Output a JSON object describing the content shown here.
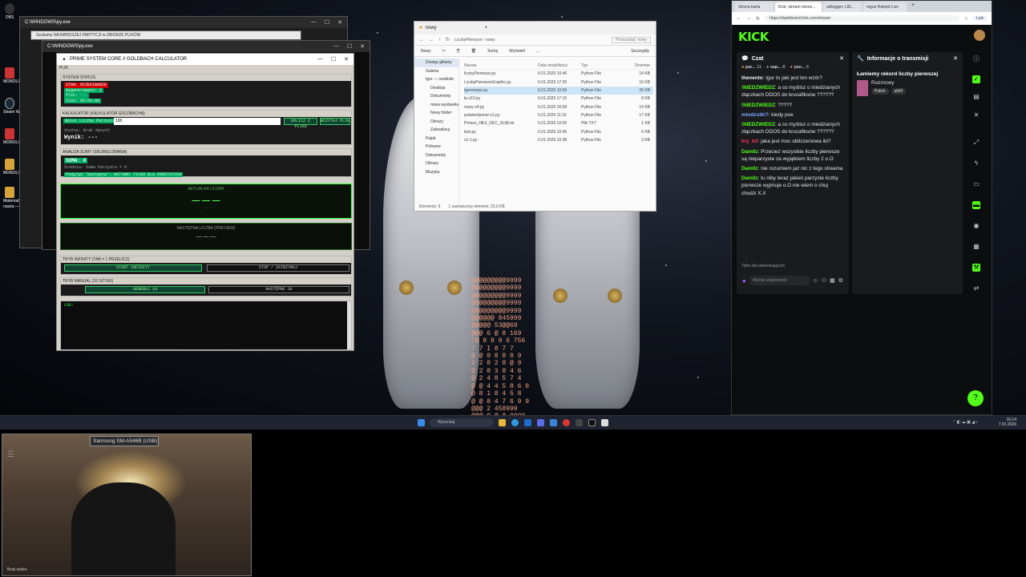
{
  "desktop": {
    "icons": [
      {
        "label": "OBS"
      },
      {
        "label": "MONOLI"
      },
      {
        "label": "Steam W..."
      },
      {
        "label": "MONOLI"
      },
      {
        "label": "MONOLI"
      },
      {
        "label": "MONOLI"
      },
      {
        "label": "Matematyczny"
      },
      {
        "label": "nauka — kopia"
      }
    ],
    "wallpaper_matrix": "@@@@@@@@@9999\n@@@@@@@@@9999\n@@@@@@@@@9999\n@@@@@@@@@9999\n@@@@@@@@@9999\n@@@@@@ 845999\n@@@@@ 53@@69\n@@@ 6 @ 8 169\n7@ 8 8 9 6 756\n7 7 I 8 7 7\n@ @ 0 8 8 0 9\n2 2 8 2 8 @ 9\n@ 2 8 3 8 4 6\n@ 2 4 8 5 7 4\n@ @ 4 4 5 8 6 0\n@ 8 1 8 4 5 8\n@ @ 8 4 7 6 9 9\n@@@ 2 458999\n@@@ 9 @ 8 9999\n@@@ 8 @ 9999\n@@@@@@@@@9999\n@@@@@@@@@9999\n@@@@@@@@@9999"
  },
  "console_windows": [
    {
      "title": "C:\\WINDOWS\\py.exe",
      "controls": [
        "—",
        "☐",
        "✕"
      ]
    },
    {
      "title": "Szukamy NAJWIĘKSZEJ PARTYCJI w ZBIORZE PLIKÓW",
      "controls": []
    },
    {
      "title": "C:\\WINDOWS\\py.exe",
      "controls": [
        "—",
        "☐",
        "✕"
      ]
    }
  ],
  "pyapp": {
    "title": "PRIME SYSTEM CORE // GOLDBACH CALCULATOR",
    "menu": "PLIK",
    "system_status": {
      "header": "SYSTEM STATUS",
      "lines": [
        "STAN: OCZEKIWANIE",
        "Wygenerowano: 0",
        "Plik: ---",
        "Czas: 00:00:00"
      ]
    },
    "goldbach": {
      "header": "KALKULATOR (KALKULATOR GOLDBACHA)",
      "input_label": "Wpisz Liczbę Parzystą:",
      "input_value": "100",
      "btn_load": "DOLICZ Z PLIKU",
      "btn_read": "WCZYTAJ PLIK",
      "status": "Status: Brak danych",
      "result_label": "Wynik:",
      "result_value": "---"
    },
    "sum_analysis": {
      "header": "ANALIZA SUMY (SKUMULOWANA)",
      "sum_label": "SUMA: 0",
      "line1": "Średnia: Suma Parzysta = 0",
      "line2": "Podgląd 'Następna': AKTYWNY TYLKO DLA PARZYSTYCH"
    },
    "current_number": {
      "label": "AKTUALNA LICZBA",
      "value": "— — —",
      "sub": "..."
    },
    "next_number": {
      "label": "NASTĘPNA LICZBA (PREVIEW)",
      "value": "— — —",
      "sub": "..."
    },
    "infinity_mode": {
      "header": "TRYB INFINITY (TAB = 1 PRZELICZ)",
      "btn_start": "START INFINITY",
      "btn_stop": "STOP / ZATRZYMAJ"
    },
    "manual_mode": {
      "header": "TRYB MANUAL (10 SZTUK)",
      "btn_gen": "GENERUJ 10",
      "btn_next": "NASTĘPNE 10"
    },
    "log_label": "LOG:"
  },
  "explorer": {
    "tab_title": "nowy",
    "new_tab": "+",
    "breadcrumb": [
      "LiczbyPierwsze",
      "nowy"
    ],
    "search_placeholder": "Przeszukaj: nowy",
    "toolbar": {
      "new": "Nowy",
      "sort": "Sortuj",
      "view": "Wyświetl",
      "more": "...",
      "details": "Szczegóły"
    },
    "nav": [
      "Dostęp główny",
      "Galeria",
      "Igor — osobiste",
      "Desktop",
      "Dokumenty",
      "nowa wystawka",
      "Nowy folder",
      "Obrazy",
      "Zaktualizuj",
      "Pulpit",
      "Pobrane",
      "Dokumenty",
      "Obrazy",
      "Muzyka"
    ],
    "columns": [
      "Nazwa",
      "Data modyfikacji",
      "Typ",
      "Rozmiar"
    ],
    "files": [
      {
        "name": "liczbyPierwsze.py",
        "date": "6.01.2026 10:46",
        "type": "Python File",
        "size": "14 KB"
      },
      {
        "name": "LiczbyPierwszeGraphic.py",
        "date": "6.01.2026 17:20",
        "type": "Python File",
        "size": "16 KB"
      },
      {
        "name": "Igorrempe.py",
        "date": "6.01.2026 10:56",
        "type": "Python File",
        "size": "25 KB"
      },
      {
        "name": "lp-v10.py",
        "date": "6.01.2026 17:15",
        "type": "Python File",
        "size": "8 KB"
      },
      {
        "name": "nowy-v4.py",
        "date": "6.01.2026 16:58",
        "type": "Python File",
        "size": "14 KB"
      },
      {
        "name": "potwierdzenie-v1.py",
        "date": "6.01.2026 11:32",
        "type": "Python File",
        "size": "17 KB"
      },
      {
        "name": "Primes_HEX_DEC_SUM.txt",
        "date": "6.01.2026 10:55",
        "type": "Plik TXT",
        "size": "1 KB"
      },
      {
        "name": "test.py",
        "date": "6.01.2026 10:45",
        "type": "Python File",
        "size": "6 KB"
      },
      {
        "name": "v1-1.py",
        "date": "6.01.2026 10:38",
        "type": "Python File",
        "size": "3 KB"
      }
    ],
    "status_items": "Elementy: 9",
    "status_selected": "1 zaznaczony element, 20,0 KB"
  },
  "browser": {
    "tabs": [
      "Strona karta",
      "Kick: stream mines...",
      "sellogger: LIE...",
      "mguri Rokpol Live"
    ],
    "url": "https://dashboard.kick.com/stream",
    "profile": "Lisk",
    "logo": "KICK",
    "chat": {
      "title": "Czat",
      "top_users": [
        {
          "name": "par...",
          "n": "11"
        },
        {
          "name": "sap...",
          "n": "8"
        },
        {
          "name": "yan...",
          "n": "6"
        }
      ],
      "messages": [
        {
          "user": "thevento",
          "color": "#f2f2f2",
          "text": "Igor to jaki jest ten wzór?"
        },
        {
          "user": "!NIEDZWIEDZ",
          "color": "#53fc18",
          "text": "a co myślisz o miedzianych złączkach DDOS do krucafiksów ??????"
        },
        {
          "user": "!NIEDZWIEDZ",
          "color": "#53fc18",
          "text": "?????"
        },
        {
          "user": "miodzutki?",
          "color": "#7aa7ff",
          "text": "kiedy poe"
        },
        {
          "user": "!NIEDZWIEDZ",
          "color": "#53fc18",
          "text": "a co myślisz o miedzianych złączkach DDOS do krucafiksów ??????"
        },
        {
          "user": "kry_kti",
          "color": "#ff3b5c",
          "text": "jaka jest moc obliczeniowa ibi?"
        },
        {
          "user": "Dam0z",
          "color": "#53fc18",
          "text": "Przecież wszystkie liczby pierwsze są nieparzyste za wyjątkiem liczby 2 o.O"
        },
        {
          "user": "Dam0z",
          "color": "#53fc18",
          "text": "nie rozumiem jaz nic z tego streama"
        },
        {
          "user": "Dam0z",
          "color": "#53fc18",
          "text": "tu niby teraz jakieś parzyste liczby pierwsze wyjmuje o.O nie wiem o chuj chodzi X.X"
        }
      ],
      "followers_only": "Tylko dla obserwujących",
      "send_placeholder": "Wyślij wiadomość"
    },
    "stream_info": {
      "title": "Informacje o transmisji",
      "stream_title": "Łamiemy rekord liczby pierwszej",
      "category": "Rozmowy",
      "tags": [
        "Polish",
        "alt42"
      ]
    }
  },
  "taskbar": {
    "search_placeholder": "Wyszukaj",
    "time": "16:14",
    "date": "7.01.2026"
  },
  "webcam": {
    "device_label": "Samsung SM-A546B (USB)",
    "corner_label": "Brak wideo"
  }
}
